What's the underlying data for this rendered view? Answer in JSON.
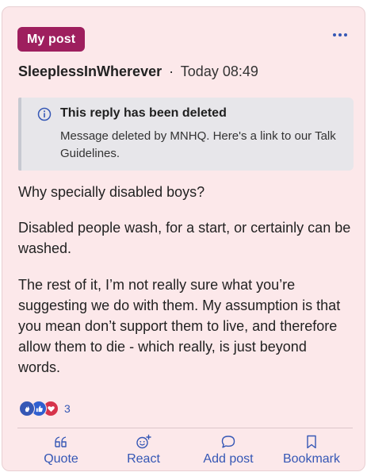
{
  "post": {
    "badge": "My post",
    "author": "SleeplessInWherever",
    "separator": "·",
    "timestamp": "Today 08:49"
  },
  "deleted_notice": {
    "title": "This reply has been deleted",
    "message": "Message deleted by MNHQ. Here's a link to our Talk Guidelines."
  },
  "body": {
    "paragraphs": [
      "Why specially disabled boys?",
      "Disabled people wash, for a start, or certainly can be washed.",
      "The rest of it, I’m not really sure what you’re suggesting we do with them. My assumption is that you mean don’t support them to live, and therefore allow them to die - which really, is just beyond words."
    ]
  },
  "reactions": {
    "count": "3",
    "icons": [
      "clap-icon",
      "thumbs-up-icon",
      "heart-icon"
    ]
  },
  "actions": {
    "quote": "Quote",
    "react": "React",
    "add_post": "Add post",
    "bookmark": "Bookmark"
  },
  "colors": {
    "card_bg": "#fce8ea",
    "badge_bg": "#9e1f5e",
    "accent_blue": "#3557b5",
    "heart_red": "#d6334b"
  }
}
